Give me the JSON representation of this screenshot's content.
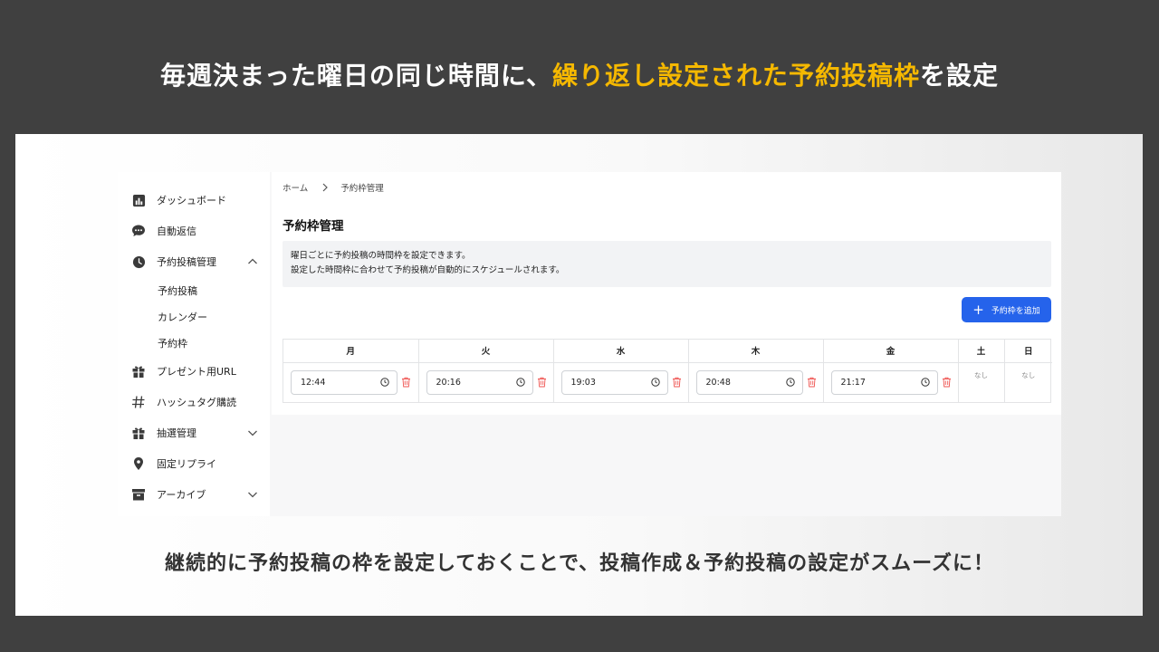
{
  "headline": {
    "part1": "毎週決まった曜日の同じ時間に、",
    "highlight": "繰り返し設定された予約投稿枠",
    "part2": "を設定",
    "highlight_color": "#f5b800"
  },
  "sidebar": {
    "items": [
      {
        "label": "ダッシュボード",
        "icon": "bar-chart-icon"
      },
      {
        "label": "自動返信",
        "icon": "chat-bubble-icon"
      },
      {
        "label": "予約投稿管理",
        "icon": "clock-icon",
        "expanded": true,
        "children": [
          "予約投稿",
          "カレンダー",
          "予約枠"
        ]
      },
      {
        "label": "プレゼント用URL",
        "icon": "gift-icon"
      },
      {
        "label": "ハッシュタグ購読",
        "icon": "hash-icon"
      },
      {
        "label": "抽選管理",
        "icon": "gift-icon",
        "expanded": false
      },
      {
        "label": "固定リプライ",
        "icon": "pin-icon"
      },
      {
        "label": "アーカイブ",
        "icon": "archive-icon",
        "expanded": false
      }
    ]
  },
  "breadcrumb": {
    "home": "ホーム",
    "current": "予約枠管理"
  },
  "page": {
    "title": "予約枠管理",
    "info_line1": "曜日ごとに予約投稿の時間枠を設定できます。",
    "info_line2": "設定した時間枠に合わせて予約投稿が自動的にスケジュールされます。",
    "add_button": "予約枠を追加",
    "accent_color": "#2563eb"
  },
  "slots": {
    "days": [
      "月",
      "火",
      "水",
      "木",
      "金",
      "土",
      "日"
    ],
    "times": [
      "12:44",
      "20:16",
      "19:03",
      "20:48",
      "21:17"
    ],
    "none_label": "なし"
  },
  "bottom": {
    "text": "継続的に予約投稿の枠を設定しておくことで、投稿作成＆予約投稿の設定がスムーズに！"
  }
}
